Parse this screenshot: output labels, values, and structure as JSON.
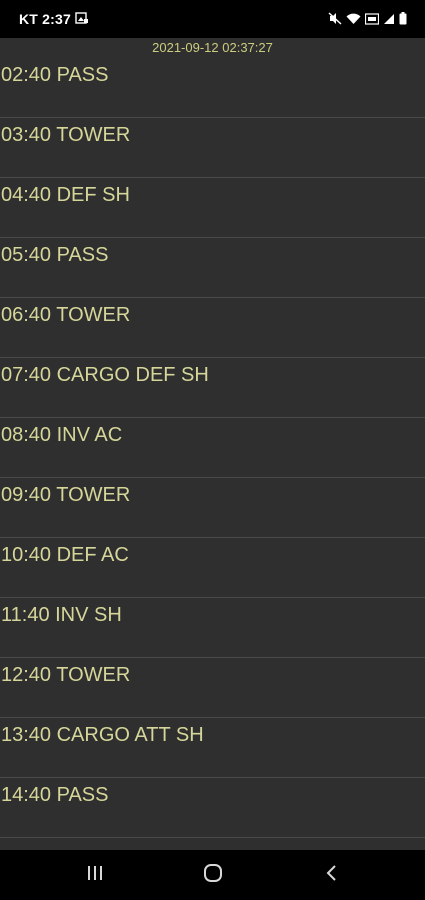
{
  "status_bar": {
    "time": "KT 2:37",
    "icons": [
      "screenshot-icon",
      "mute-icon",
      "wifi-icon",
      "lte-icon",
      "signal-icon",
      "battery-icon"
    ]
  },
  "app": {
    "timestamp": "2021-09-12 02:37:27",
    "items": [
      {
        "label": "02:40 PASS"
      },
      {
        "label": "03:40 TOWER"
      },
      {
        "label": "04:40 DEF SH"
      },
      {
        "label": "05:40 PASS"
      },
      {
        "label": "06:40 TOWER"
      },
      {
        "label": "07:40 CARGO DEF SH"
      },
      {
        "label": "08:40 INV AC"
      },
      {
        "label": "09:40 TOWER"
      },
      {
        "label": "10:40 DEF AC"
      },
      {
        "label": "11:40 INV SH"
      },
      {
        "label": "12:40 TOWER"
      },
      {
        "label": "13:40 CARGO ATT SH"
      },
      {
        "label": "14:40 PASS"
      }
    ]
  },
  "nav_bar": {
    "buttons": [
      "recent-apps-icon",
      "home-icon",
      "back-icon"
    ]
  },
  "colors": {
    "background": "#2f2f2f",
    "text": "#d6d69a",
    "timestamp": "#cccc80",
    "divider": "#4a4a4a"
  }
}
